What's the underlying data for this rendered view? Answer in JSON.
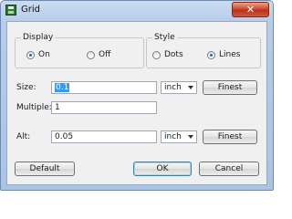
{
  "window": {
    "title": "Grid",
    "close_glyph": "✕",
    "app_icon": "grid-app-icon"
  },
  "display": {
    "label": "Display",
    "options": [
      {
        "label": "On",
        "checked": true
      },
      {
        "label": "Off",
        "checked": false
      }
    ]
  },
  "style": {
    "label": "Style",
    "options": [
      {
        "label": "Dots",
        "checked": false
      },
      {
        "label": "Lines",
        "checked": true
      }
    ]
  },
  "size": {
    "label": "Size:",
    "value": "0.1",
    "unit": "inch",
    "button": "Finest"
  },
  "multiple": {
    "label": "Multiple:",
    "value": "1"
  },
  "alt": {
    "label": "Alt:",
    "value": "0.05",
    "unit": "inch",
    "button": "Finest"
  },
  "footer": {
    "default_label": "Default",
    "ok_label": "OK",
    "cancel_label": "Cancel"
  }
}
